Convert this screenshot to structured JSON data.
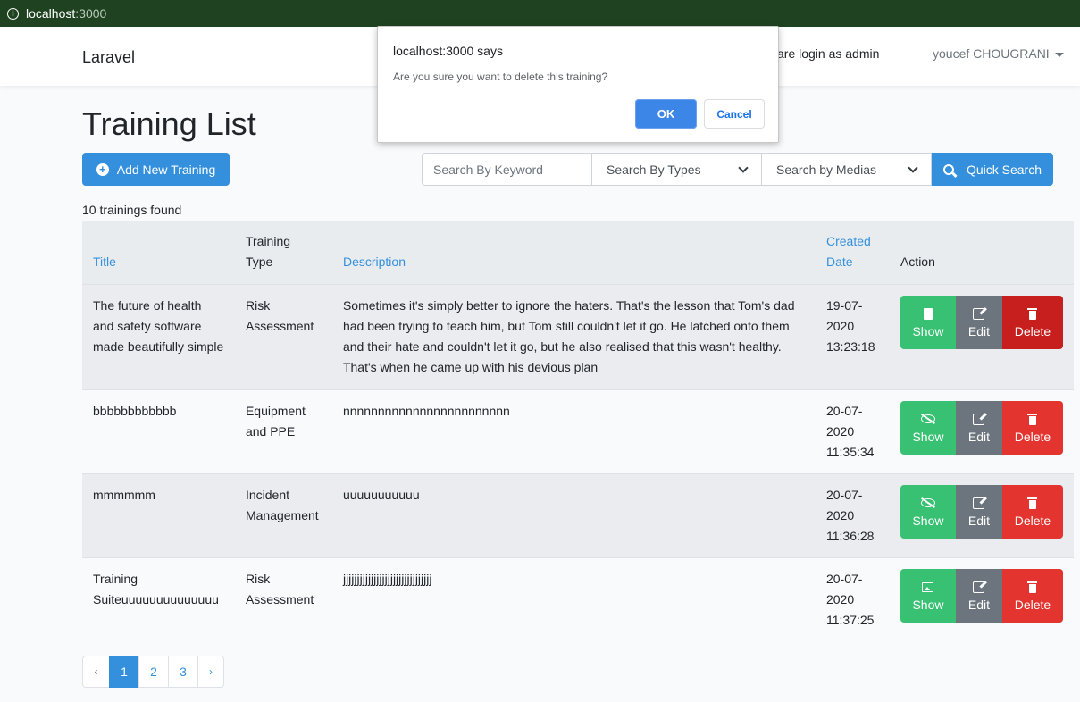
{
  "browser": {
    "url_host": "localhost",
    "url_port": ":3000"
  },
  "navbar": {
    "brand": "Laravel",
    "message": "are login as admin",
    "user": "youcef CHOUGRANI"
  },
  "page": {
    "title": "Training List",
    "add_button": "Add New Training",
    "count_text": "10 trainings found"
  },
  "search": {
    "keyword_placeholder": "Search By Keyword",
    "types_selected": "Search By Types",
    "medias_selected": "Search by Medias",
    "button": "Quick Search"
  },
  "table": {
    "headers": {
      "title": "Title",
      "type_line1": "Training",
      "type_line2": "Type",
      "description": "Description",
      "created_line1": "Created",
      "created_line2": "Date",
      "action": "Action"
    },
    "rows": [
      {
        "title": "The future of health and safety software made beautifully simple",
        "type": "Risk Assessment",
        "description": "Sometimes it's simply better to ignore the haters. That's the lesson that Tom's dad had been trying to teach him, but Tom still couldn't let it go. He latched onto them and their hate and couldn't let it go, but he also realised that this wasn't healthy. That's when he came up with his devious plan",
        "date_line1": "19-07-",
        "date_line2": "2020",
        "date_line3": "13:23:18",
        "show_icon": "file-pdf-icon"
      },
      {
        "title": "bbbbbbbbbbbb",
        "type": "Equipment and PPE",
        "description": "nnnnnnnnnnnnnnnnnnnnnnnn",
        "date_line1": "20-07-",
        "date_line2": "2020",
        "date_line3": "11:35:34",
        "show_icon": "eye-slash-icon"
      },
      {
        "title": "mmmmmm",
        "type": "Incident Management",
        "description": "uuuuuuuuuuu",
        "date_line1": "20-07-",
        "date_line2": "2020",
        "date_line3": "11:36:28",
        "show_icon": "eye-slash-icon"
      },
      {
        "title": "Training Suiteuuuuuuuuuuuuuu",
        "type": "Risk Assessment",
        "description": "jjjjjjjjjjjjjjjjjjjjjjjjjjjjjjjj",
        "date_line1": "20-07-",
        "date_line2": "2020",
        "date_line3": "11:37:25",
        "show_icon": "image-icon"
      }
    ],
    "action_labels": {
      "show": "Show",
      "edit": "Edit",
      "delete": "Delete"
    }
  },
  "pagination": {
    "prev": "‹",
    "pages": [
      "1",
      "2",
      "3"
    ],
    "next": "›",
    "active": "1"
  },
  "dialog": {
    "title": "localhost:3000 says",
    "message": "Are you sure you want to delete this training?",
    "ok": "OK",
    "cancel": "Cancel"
  },
  "colors": {
    "primary": "#3490dc",
    "success": "#38c172",
    "secondary": "#6c757d",
    "danger": "#e3342f",
    "browser_bar": "#1f4320"
  }
}
